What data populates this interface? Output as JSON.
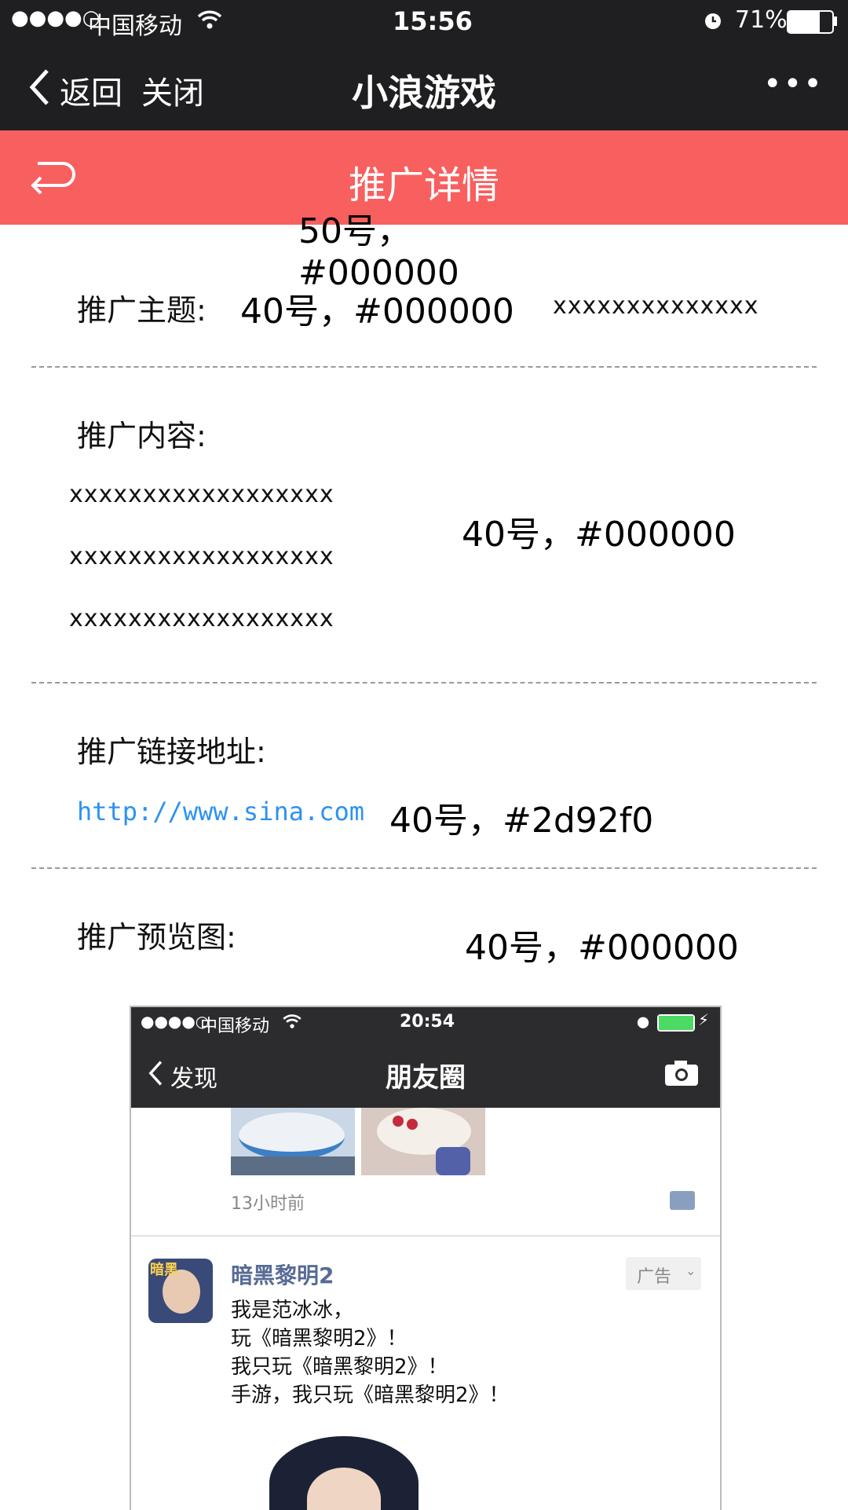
{
  "status_bar": {
    "signal": "●●●●○",
    "carrier": "中国移动",
    "time": "15:56",
    "battery_pct": "71%"
  },
  "nav": {
    "back_label": "返回",
    "close_label": "关闭",
    "title": "小浪游戏",
    "more_glyph": "•••"
  },
  "header": {
    "title": "推广详情",
    "anno": "50号，#000000"
  },
  "topic": {
    "label": "推广主题:",
    "anno": "40号，#000000",
    "value": "xxxxxxxxxxxxxx"
  },
  "content": {
    "label": "推广内容:",
    "lines": [
      "xxxxxxxxxxxxxxxxxx",
      "xxxxxxxxxxxxxxxxxx",
      "xxxxxxxxxxxxxxxxxx"
    ],
    "anno": "40号，#000000"
  },
  "link": {
    "label": "推广链接地址:",
    "url": "http://www.sina.com",
    "anno": "40号，#2d92f0"
  },
  "preview": {
    "label": "推广预览图:",
    "anno": "40号，#000000",
    "phone": {
      "signal": "●●●●○",
      "carrier": "中国移动",
      "time": "20:54",
      "back_label": "发现",
      "title": "朋友圈",
      "time_ago": "13小时前",
      "ad_name": "暗黑黎明2",
      "ad_badge": "广告",
      "ad_icon_text": "暗黑",
      "ad_lines": [
        "我是范冰冰，",
        "玩《暗黑黎明2》！",
        "我只玩《暗黑黎明2》！",
        "手游，我只玩《暗黑黎明2》！"
      ]
    }
  },
  "colors": {
    "navbar": "#1f1f21",
    "header": "#f85f5f",
    "link": "#2d92f0",
    "wechat_name": "#576b95"
  }
}
